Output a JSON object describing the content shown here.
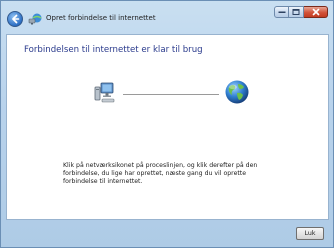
{
  "window": {
    "title": "Opret forbindelse til internettet"
  },
  "content": {
    "heading": "Forbindelsen til internettet er klar til brug",
    "info_text": "Klik på netværksikonet på proceslinjen, og klik derefter på den forbindelse, du lige har oprettet, næste gang du vil oprette forbindelse til internettet."
  },
  "footer": {
    "close_label": "Luk"
  },
  "icons": {
    "back": "back-arrow-icon",
    "wizard": "network-wizard-icon",
    "computer": "computer-icon",
    "globe": "globe-icon"
  },
  "colors": {
    "heading": "#2a3a8c",
    "frame": "#b9d3ec",
    "close_caption": "#d2533a"
  }
}
